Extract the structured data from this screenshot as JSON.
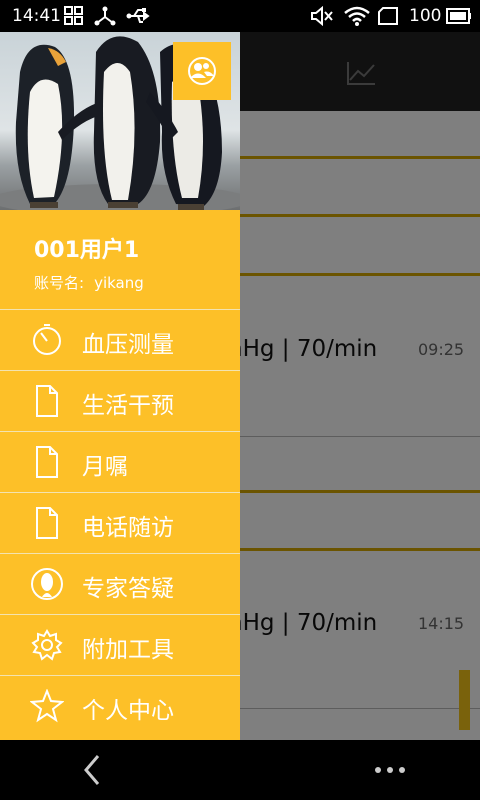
{
  "status_bar": {
    "time": "14:41",
    "battery": "100"
  },
  "background_list": {
    "entries": [
      {
        "value": "nHg | 70/min",
        "time": "09:25"
      },
      {
        "value": "nHg | 70/min",
        "time": "14:15"
      }
    ]
  },
  "drawer": {
    "user_name": "001用户1",
    "account_label": "账号名:",
    "account_value": "yikang",
    "menu": [
      {
        "label": "血压测量",
        "icon": "timer-icon"
      },
      {
        "label": "生活干预",
        "icon": "document-icon"
      },
      {
        "label": "月嘱",
        "icon": "document-icon"
      },
      {
        "label": "电话随访",
        "icon": "document-icon"
      },
      {
        "label": "专家答疑",
        "icon": "expert-icon"
      },
      {
        "label": "附加工具",
        "icon": "gear-icon"
      },
      {
        "label": "个人中心",
        "icon": "star-icon"
      }
    ]
  },
  "colors": {
    "drawer_yellow": "#fdc028",
    "rule_gold": "#d6a800"
  }
}
